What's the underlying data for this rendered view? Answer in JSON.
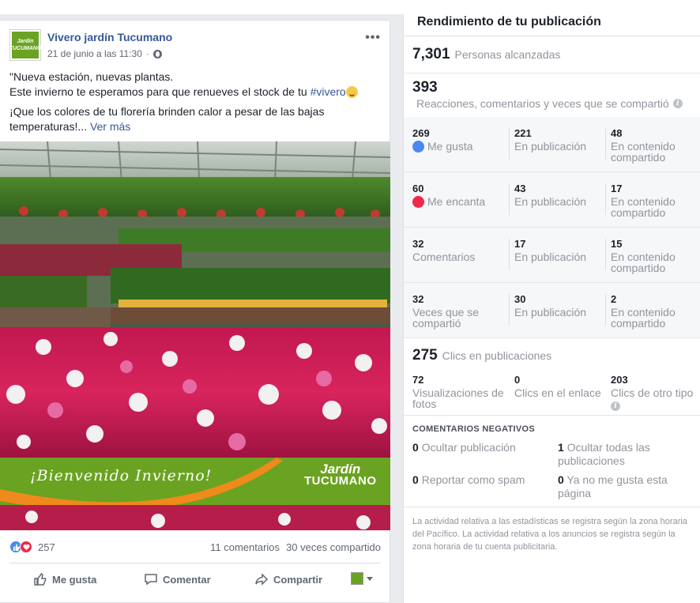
{
  "post": {
    "page_name": "Vivero jardín Tucumano",
    "logo_text_line1": "Jardín",
    "logo_text_line2": "TUCUMANO",
    "date": "21 de junio a las 11:30",
    "separator": "·",
    "text_line1": "\"Nueva estación, nuevas plantas.",
    "text_line2_pre": "Este invierno te esperamos para que renueves el stock de tu ",
    "hashtag": "#vivero",
    "text_line3": "¡Que los colores de tu florería brinden calor a pesar de las bajas temperaturas!",
    "ellipsis": "...",
    "see_more": "Ver más",
    "banner_text": "¡Bienvenido Invierno!",
    "banner_brand_1": "Jardín",
    "banner_brand_2": "TUCUMANO",
    "reaction_count": "257",
    "comments": "11 comentarios",
    "shares": "30 veces compartido",
    "actions": {
      "like": "Me gusta",
      "comment": "Comentar",
      "share": "Compartir"
    }
  },
  "stats": {
    "title": "Rendimiento de tu publicación",
    "reach_value": "7,301",
    "reach_label": "Personas alcanzadas",
    "engagement_value": "393",
    "engagement_label": "Reacciones, comentarios y veces que se compartió",
    "rows": [
      {
        "c1_n": "269",
        "c1_l": "Me gusta",
        "c2_n": "221",
        "c2_l": "En publicación",
        "c3_n": "48",
        "c3_l": "En contenido compartido"
      },
      {
        "c1_n": "60",
        "c1_l": "Me encanta",
        "c2_n": "43",
        "c2_l": "En publicación",
        "c3_n": "17",
        "c3_l": "En contenido compartido"
      },
      {
        "c1_n": "32",
        "c1_l": "Comentarios",
        "c2_n": "17",
        "c2_l": "En publicación",
        "c3_n": "15",
        "c3_l": "En contenido compartido"
      },
      {
        "c1_n": "32",
        "c1_l": "Veces que se compartió",
        "c2_n": "30",
        "c2_l": "En publicación",
        "c3_n": "2",
        "c3_l": "En contenido compartido"
      }
    ],
    "clicks_value": "275",
    "clicks_label": "Clics en publicaciones",
    "clicks": {
      "c1_n": "72",
      "c1_l": "Visualizaciones de fotos",
      "c2_n": "0",
      "c2_l": "Clics en el enlace",
      "c3_n": "203",
      "c3_l": "Clics de otro tipo"
    },
    "negative_title": "COMENTARIOS NEGATIVOS",
    "negative": {
      "hide_post_n": "0",
      "hide_post_l": "Ocultar publicación",
      "hide_all_n": "1",
      "hide_all_l": "Ocultar todas las publicaciones",
      "spam_n": "0",
      "spam_l": "Reportar como spam",
      "unlike_n": "0",
      "unlike_l": "Ya no me gusta esta página"
    },
    "footnote": "La actividad relativa a las estadísticas se registra según la zona horaria del Pacífico. La actividad relativa a los anuncios se registra según la zona horaria de tu cuenta publicitaria."
  },
  "icons": {
    "more": "more-horizontal-icon",
    "privacy": "globe-icon",
    "like": "thumbs-up-icon",
    "love": "heart-icon",
    "comment": "speech-bubble-icon",
    "share": "share-arrow-icon",
    "info": "info-icon"
  },
  "colors": {
    "link": "#365899",
    "like_blue": "#4a89f3",
    "love_red": "#f0284a",
    "brand_green": "#6aa321",
    "banner_orange": "#f08a1c"
  }
}
